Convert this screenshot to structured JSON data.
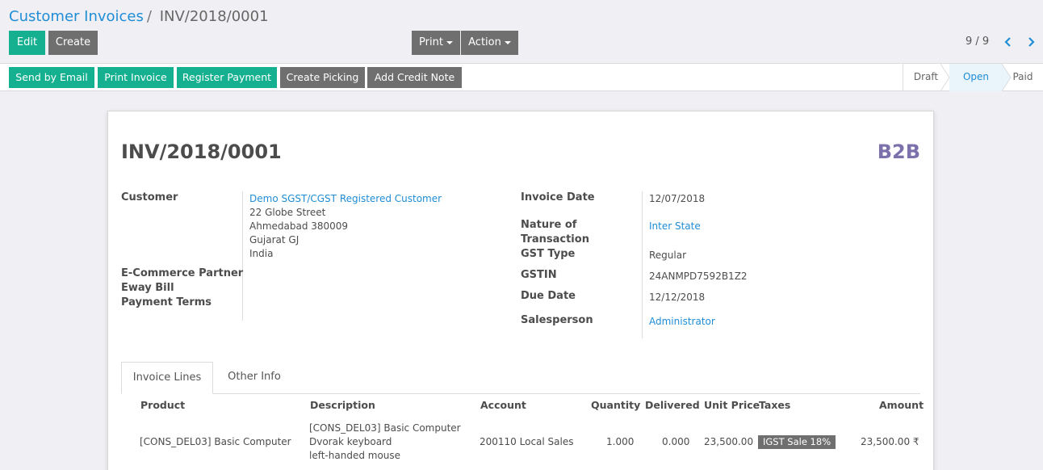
{
  "breadcrumb": {
    "parent": "Customer Invoices",
    "separator": "/",
    "current": "INV/2018/0001"
  },
  "toolbar": {
    "edit": "Edit",
    "create": "Create",
    "print": "Print",
    "action": "Action"
  },
  "pager": {
    "value": "9 / 9"
  },
  "statusbar": {
    "buttons": [
      "Send by Email",
      "Print Invoice",
      "Register Payment",
      "Create Picking",
      "Add Credit Note"
    ],
    "stages": [
      "Draft",
      "Open",
      "Paid"
    ],
    "active_stage": "Open"
  },
  "invoice": {
    "number": "INV/2018/0001",
    "type_badge": "B2B",
    "labels": {
      "customer": "Customer",
      "ecommerce": "E-Commerce Partner",
      "eway": "Eway Bill",
      "payment_terms": "Payment Terms",
      "invoice_date": "Invoice Date",
      "nature_1": "Nature of",
      "nature_2": "Transaction",
      "gst_type": "GST Type",
      "gstin": "GSTIN",
      "due_date": "Due Date",
      "salesperson": "Salesperson"
    },
    "customer": {
      "name": "Demo SGST/CGST Registered Customer",
      "address": [
        "22 Globe Street",
        "Ahmedabad 380009",
        "Gujarat GJ",
        "India"
      ]
    },
    "invoice_date": "12/07/2018",
    "nature_of_transaction": "Inter State",
    "gst_type": "Regular",
    "gstin": "24ANMPD7592B1Z2",
    "due_date": "12/12/2018",
    "salesperson": "Administrator"
  },
  "tabs": [
    "Invoice Lines",
    "Other Info"
  ],
  "lines": {
    "headers": [
      "Product",
      "Description",
      "Account",
      "Quantity",
      "Delivered",
      "Unit Price",
      "Taxes",
      "Amount"
    ],
    "rows": [
      {
        "product": "[CONS_DEL03] Basic Computer",
        "description": [
          "[CONS_DEL03] Basic Computer",
          "Dvorak keyboard",
          "left-handed mouse"
        ],
        "account": "200110 Local Sales",
        "quantity": "1.000",
        "delivered": "0.000",
        "unit_price": "23,500.00",
        "taxes": "IGST Sale 18%",
        "amount": "23,500.00 ₹"
      }
    ]
  },
  "colors": {
    "primary": "#14b08f",
    "secondary": "#6f6f6f",
    "link": "#1f8dd6",
    "badge": "#7c71ab"
  }
}
